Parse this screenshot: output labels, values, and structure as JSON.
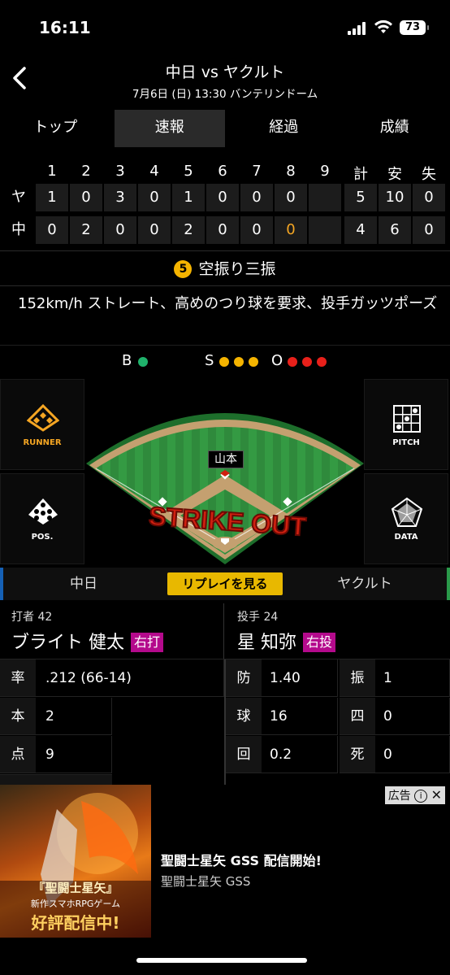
{
  "status": {
    "time": "16:11",
    "battery": "73"
  },
  "header": {
    "title": "中日 vs ヤクルト",
    "subtitle": "7月6日 (日) 13:30 バンテリンドーム"
  },
  "tabs": [
    {
      "label": "トップ",
      "active": false
    },
    {
      "label": "速報",
      "active": true
    },
    {
      "label": "経過",
      "active": false
    },
    {
      "label": "成績",
      "active": false
    }
  ],
  "scoreboard": {
    "headers": [
      "1",
      "2",
      "3",
      "4",
      "5",
      "6",
      "7",
      "8",
      "9",
      "計",
      "安",
      "失"
    ],
    "rows": [
      {
        "team": "ヤ",
        "cells": [
          "1",
          "0",
          "3",
          "0",
          "1",
          "0",
          "0",
          "0",
          "",
          "5",
          "10",
          "0"
        ]
      },
      {
        "team": "中",
        "cells": [
          "0",
          "2",
          "0",
          "0",
          "2",
          "0",
          "0",
          "0",
          "",
          "4",
          "6",
          "0"
        ]
      }
    ],
    "live_color": "#f5a623"
  },
  "play": {
    "out_number": "5",
    "result": "空振り三振",
    "comment": "152km/h ストレート、高めのつり球を要求、投手ガッツポーズ"
  },
  "count": {
    "b_label": "B",
    "s_label": "S",
    "o_label": "O",
    "balls": 1,
    "strikes": 3,
    "outs": 3,
    "ball_color": "#1fb26b",
    "strike_color": "#f5b400",
    "out_color": "#e8201a"
  },
  "field": {
    "runner_label": "RUNNER",
    "pos_label": "POS.",
    "pitch_label": "PITCH",
    "data_label": "DATA",
    "pitcher_tag": "山本",
    "banner": "STRIKE OUT"
  },
  "teams_bar": {
    "home": "中日",
    "replay": "リプレイを見る",
    "away": "ヤクルト"
  },
  "batter": {
    "pos": "打者 42",
    "name": "ブライト 健太",
    "hand": "右打",
    "stats": [
      {
        "key": "率",
        "value": ".212 (66-14)"
      },
      {
        "key": "本",
        "value": "2"
      },
      {
        "key": "点",
        "value": "9"
      }
    ]
  },
  "pitcher": {
    "pos": "投手 24",
    "name": "星 知弥",
    "hand": "右投",
    "stats": [
      {
        "key": "防",
        "value": "1.40"
      },
      {
        "key": "振",
        "value": "1"
      },
      {
        "key": "球",
        "value": "16"
      },
      {
        "key": "四",
        "value": "0"
      },
      {
        "key": "回",
        "value": "0.2"
      },
      {
        "key": "死",
        "value": "0"
      }
    ]
  },
  "ad": {
    "badge": "広告",
    "title": "聖闘士星矢 GSS 配信開始!",
    "sponsor": "聖闘士星矢 GSS",
    "image_caption_1": "『聖闘士星矢』",
    "image_caption_2": "新作スマホRPGゲーム",
    "image_caption_3": "好評配信中!"
  }
}
